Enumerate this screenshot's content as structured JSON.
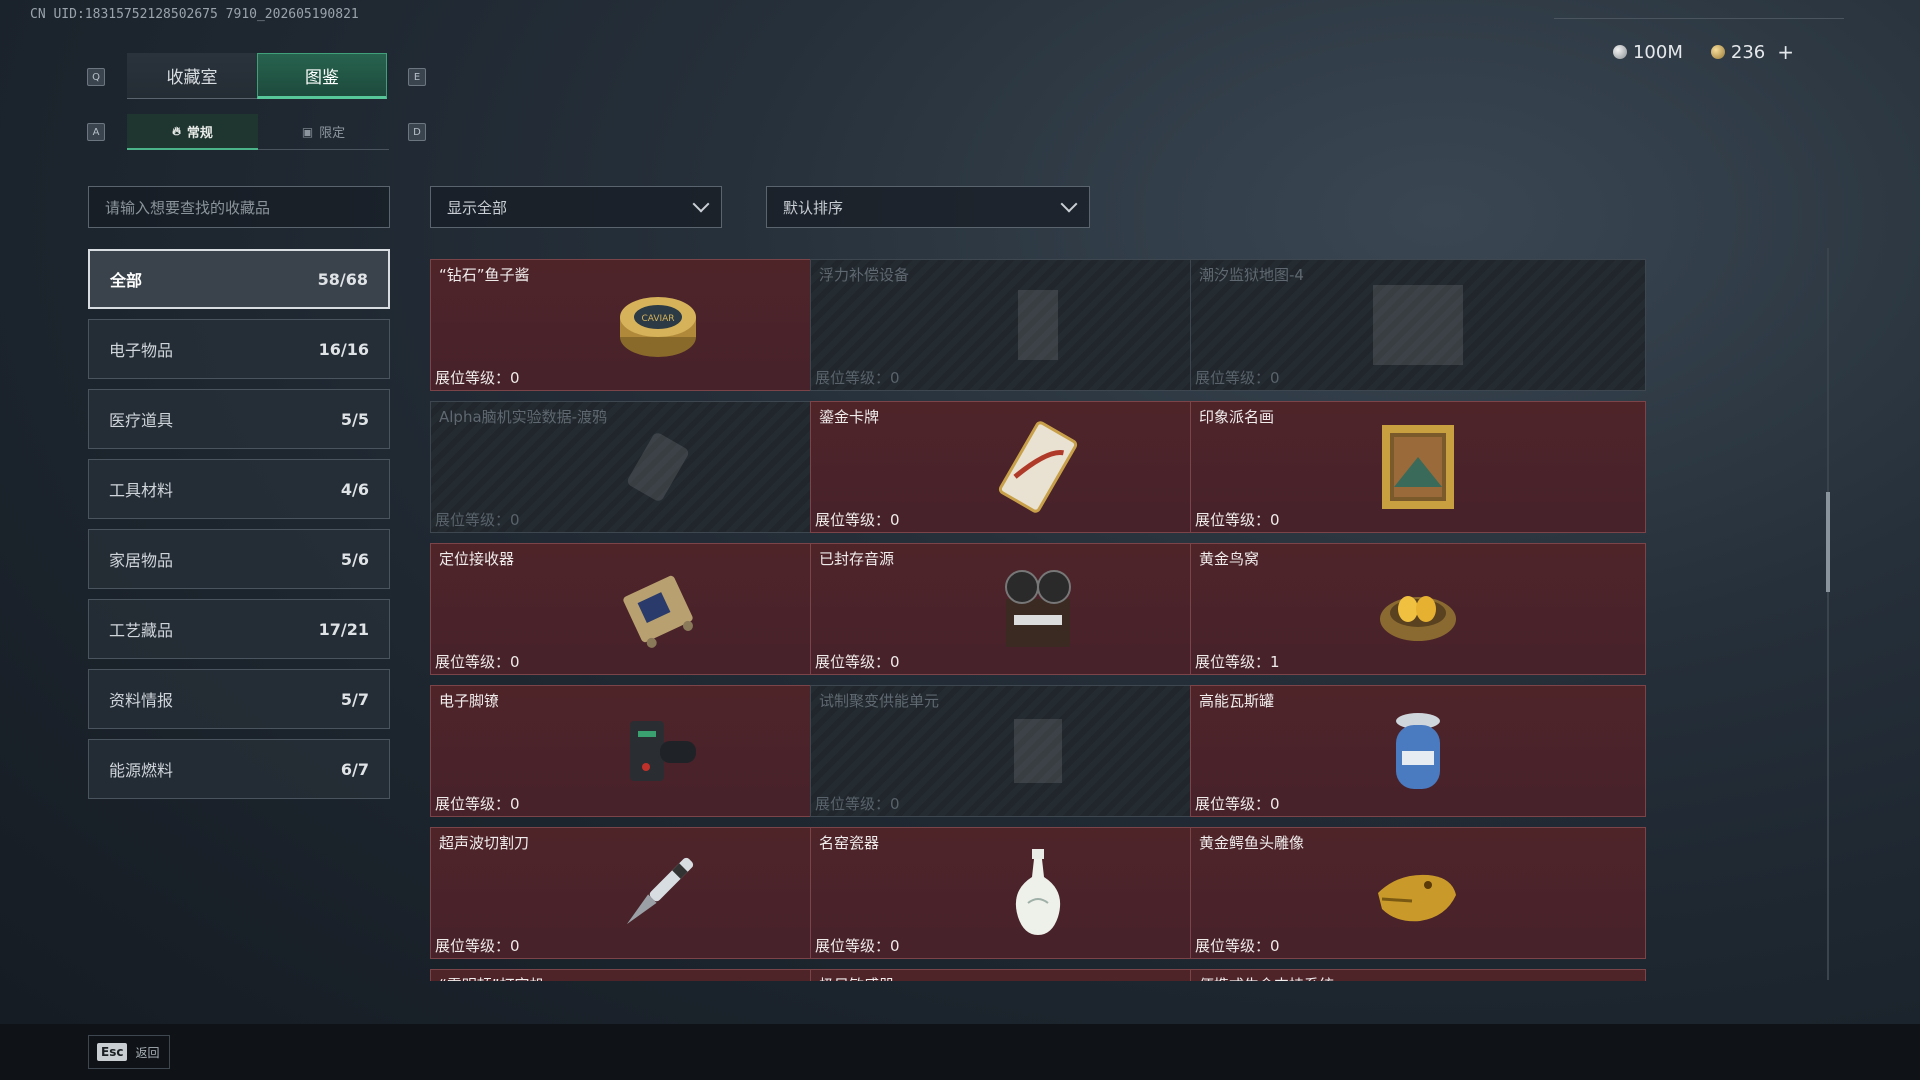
{
  "uid": "CN UID:18315752128502675 7910_202605190821",
  "currency": {
    "silver": "100M",
    "gold": "236",
    "plus": "+"
  },
  "keys": {
    "prev_main": "Q",
    "next_main": "E",
    "prev_sub": "A",
    "next_sub": "D"
  },
  "tabs": [
    {
      "label": "收藏室",
      "active": false
    },
    {
      "label": "图鉴",
      "active": true
    }
  ],
  "subtabs": [
    {
      "label": "常规",
      "icon": "flame-icon",
      "active": true
    },
    {
      "label": "限定",
      "icon": "frame-icon",
      "active": false
    }
  ],
  "search": {
    "placeholder": "请输入想要查找的收藏品"
  },
  "filters": {
    "display": "显示全部",
    "sort": "默认排序"
  },
  "categories": [
    {
      "label": "全部",
      "count": "58/68",
      "active": true
    },
    {
      "label": "电子物品",
      "count": "16/16",
      "active": false
    },
    {
      "label": "医疗道具",
      "count": "5/5",
      "active": false
    },
    {
      "label": "工具材料",
      "count": "4/6",
      "active": false
    },
    {
      "label": "家居物品",
      "count": "5/6",
      "active": false
    },
    {
      "label": "工艺藏品",
      "count": "17/21",
      "active": false
    },
    {
      "label": "资料情报",
      "count": "5/7",
      "active": false
    },
    {
      "label": "能源燃料",
      "count": "6/7",
      "active": false
    }
  ],
  "level_label": "展位等级：",
  "items": [
    {
      "name": "“钻石”鱼子酱",
      "level": "0",
      "locked": false,
      "icon": "caviar-tin-icon"
    },
    {
      "name": "浮力补偿设备",
      "level": "0",
      "locked": true,
      "icon": "bcd-device-icon"
    },
    {
      "name": "潮汐监狱地图-4",
      "level": "0",
      "locked": true,
      "icon": "map-icon"
    },
    {
      "name": "Alpha脑机实验数据-渡鸦",
      "level": "0",
      "locked": true,
      "icon": "data-drive-icon"
    },
    {
      "name": "鎏金卡牌",
      "level": "0",
      "locked": false,
      "icon": "gilded-card-icon"
    },
    {
      "name": "印象派名画",
      "level": "0",
      "locked": false,
      "icon": "framed-painting-icon"
    },
    {
      "name": "定位接收器",
      "level": "0",
      "locked": false,
      "icon": "gps-receiver-icon"
    },
    {
      "name": "已封存音源",
      "level": "0",
      "locked": false,
      "icon": "reel-recorder-icon"
    },
    {
      "name": "黄金鸟窝",
      "level": "1",
      "locked": false,
      "icon": "golden-nest-icon"
    },
    {
      "name": "电子脚镣",
      "level": "0",
      "locked": false,
      "icon": "ankle-monitor-icon"
    },
    {
      "name": "试制聚变供能单元",
      "level": "0",
      "locked": true,
      "icon": "fusion-cell-icon"
    },
    {
      "name": "高能瓦斯罐",
      "level": "0",
      "locked": false,
      "icon": "gas-canister-icon"
    },
    {
      "name": "超声波切割刀",
      "level": "0",
      "locked": false,
      "icon": "ultrasonic-cutter-icon"
    },
    {
      "name": "名窑瓷器",
      "level": "0",
      "locked": false,
      "icon": "porcelain-vase-icon",
      "warn": "!"
    },
    {
      "name": "黄金鳄鱼头雕像",
      "level": "0",
      "locked": false,
      "icon": "gold-crocodile-icon"
    },
    {
      "name": "“雷明顿”打字机",
      "level": "",
      "locked": false,
      "icon": "typewriter-icon"
    },
    {
      "name": "极目敏感器",
      "level": "",
      "locked": false,
      "icon": "sensor-icon",
      "warn": "!"
    },
    {
      "name": "便携式生命支持系统",
      "level": "",
      "locked": false,
      "icon": "life-support-icon"
    }
  ],
  "footer": {
    "key": "Esc",
    "label": "返回"
  }
}
